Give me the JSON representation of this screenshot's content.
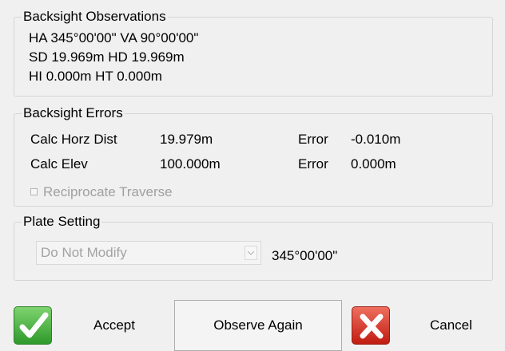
{
  "backsight_observations": {
    "title": "Backsight Observations",
    "line1": "HA 345°00'00\"  VA 90°00'00\"",
    "line2": "SD 19.969m  HD 19.969m",
    "line3": "HI 0.000m  HT 0.000m"
  },
  "backsight_errors": {
    "title": "Backsight Errors",
    "rows": [
      {
        "label": "Calc Horz Dist",
        "value": "19.979m",
        "error_label": "Error",
        "error_value": "-0.010m"
      },
      {
        "label": "Calc Elev",
        "value": "100.000m",
        "error_label": "Error",
        "error_value": "0.000m"
      }
    ],
    "reciprocate_label": "Reciprocate Traverse",
    "reciprocate_checked": false
  },
  "plate_setting": {
    "title": "Plate Setting",
    "selected": "Do Not Modify",
    "angle": "345°00'00\""
  },
  "buttons": {
    "accept": "Accept",
    "observe_again": "Observe Again",
    "cancel": "Cancel"
  },
  "icons": {
    "accept": "checkmark-icon",
    "cancel": "x-icon"
  },
  "colors": {
    "accept_green": "#2f9a2c",
    "cancel_red": "#c11c11",
    "disabled_text": "#a0a0a0"
  }
}
